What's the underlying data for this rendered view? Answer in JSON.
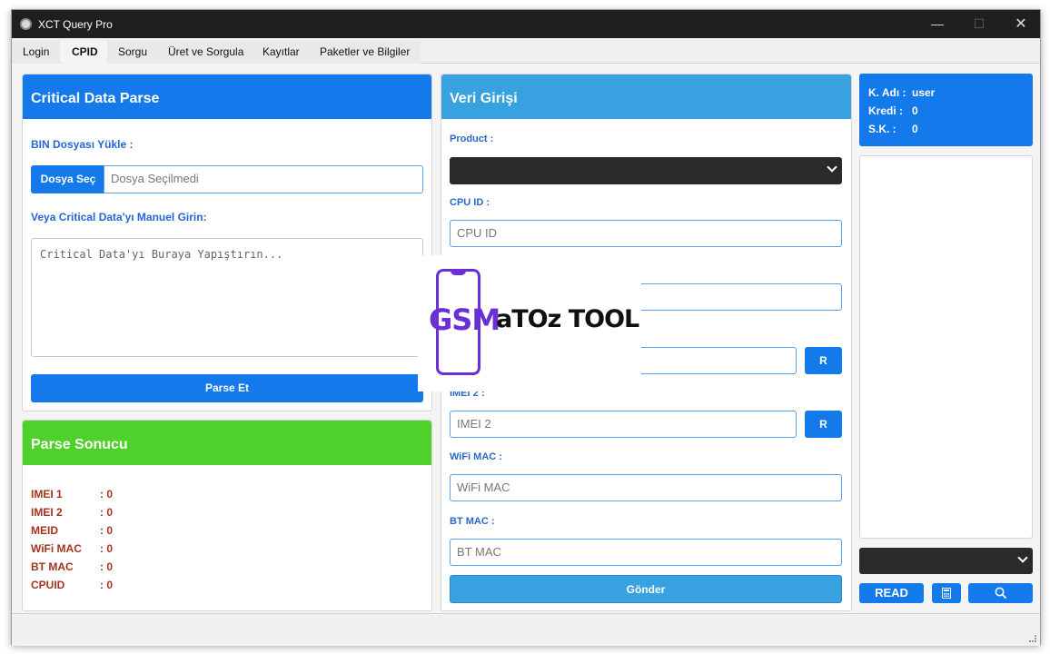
{
  "window": {
    "title": "XCT Query Pro",
    "minimize": "—",
    "maximize": "☐",
    "close": "✕"
  },
  "tabs": [
    "Login",
    "CPID",
    "Sorgu",
    "Üret ve Sorgula",
    "Kayıtlar",
    "Paketler ve Bilgiler"
  ],
  "active_tab": "CPID",
  "critical": {
    "header": "Critical Data Parse",
    "bin_label": "BIN Dosyası Yükle :",
    "file_button": "Dosya Seç",
    "file_value": "Dosya Seçilmedi",
    "manual_label": "Veya Critical Data'yı Manuel Girin:",
    "textarea_placeholder": "Critical Data'yı Buraya Yapıştırın...",
    "parse_button": "Parse Et"
  },
  "parse_result": {
    "header": "Parse Sonucu",
    "rows": [
      {
        "key": "IMEI 1",
        "value": ":  0"
      },
      {
        "key": "IMEI 2",
        "value": ":  0"
      },
      {
        "key": "MEID",
        "value": ":  0"
      },
      {
        "key": "WiFi MAC",
        "value": ":  0"
      },
      {
        "key": "BT MAC",
        "value": ":  0"
      },
      {
        "key": "CPUID",
        "value": ":  0"
      }
    ]
  },
  "veri": {
    "header": "Veri Girişi",
    "product_label": "Product :",
    "cpu_label": "CPU ID :",
    "cpu_placeholder": "CPU ID",
    "imei2_label": "IMEI 2 :",
    "imei2_placeholder": "IMEI 2",
    "r_button": "R",
    "wifi_label": "WiFi MAC :",
    "wifi_placeholder": "WiFi MAC",
    "bt_label": "BT MAC :",
    "bt_placeholder": "BT MAC",
    "send_button": "Gönder"
  },
  "user": {
    "name_key": "K. Adı :",
    "name_value": "user",
    "credit_key": "Kredi :",
    "credit_value": "0",
    "sk_key": "S.K. :",
    "sk_value": "0"
  },
  "right_buttons": {
    "read": "READ"
  },
  "watermark": {
    "gsm": "GSM",
    "tool": "aTOz TOOL"
  },
  "colors": {
    "primary": "#1479ea",
    "green": "#4fd12c",
    "lightblue": "#38a1e0",
    "result_text": "#a3331c"
  }
}
